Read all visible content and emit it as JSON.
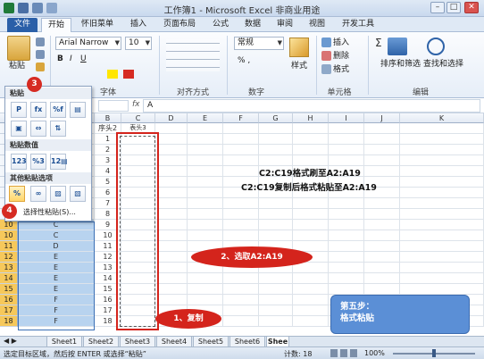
{
  "title_bar": {
    "title": "工作簿1 - Microsoft Excel 非商业用途"
  },
  "tabs": {
    "file": "文件",
    "items": [
      "开始",
      "怀旧菜单",
      "插入",
      "页面布局",
      "公式",
      "数据",
      "审阅",
      "视图",
      "开发工具"
    ]
  },
  "ribbon": {
    "paste_label": "粘贴",
    "font_name": "Arial Narrow",
    "font_size": "10",
    "group_font": "字体",
    "group_align": "对齐方式",
    "group_number": "数字",
    "group_cells": "单元格",
    "group_edit": "编辑",
    "number_format": "常规",
    "number_symbols": "% ,",
    "style_label": "样式",
    "insert_label": "插入",
    "delete_label": "删除",
    "format_label": "格式",
    "sort_filter_label": "排序和筛选",
    "find_select_label": "查找和选择"
  },
  "formula_bar": {
    "fx": "fx",
    "content": "A"
  },
  "columns": [
    "B",
    "C",
    "D",
    "E",
    "F",
    "G",
    "H",
    "I",
    "J",
    "K"
  ],
  "rows": [
    {
      "n": "1",
      "c": "",
      "b": "序头2"
    },
    {
      "n": "2",
      "c": "",
      "b": "1"
    },
    {
      "n": "3",
      "c": "",
      "b": "2"
    },
    {
      "n": "4",
      "c": "",
      "b": "3"
    },
    {
      "n": "5",
      "c": "",
      "b": "4"
    },
    {
      "n": "6",
      "c": "",
      "b": "5"
    },
    {
      "n": "7",
      "c": "",
      "b": "6"
    },
    {
      "n": "8",
      "c": "",
      "b": "7"
    },
    {
      "n": "9",
      "c": "",
      "b": "8"
    },
    {
      "n": "10",
      "c": "C",
      "b": "9"
    },
    {
      "n": "10",
      "c": "C",
      "b": "10"
    },
    {
      "n": "11",
      "c": "D",
      "b": "11"
    },
    {
      "n": "12",
      "c": "E",
      "b": "12"
    },
    {
      "n": "13",
      "c": "E",
      "b": "13"
    },
    {
      "n": "14",
      "c": "E",
      "b": "14"
    },
    {
      "n": "15",
      "c": "E",
      "b": "15"
    },
    {
      "n": "16",
      "c": "F",
      "b": "16"
    },
    {
      "n": "17",
      "c": "F",
      "b": "17"
    },
    {
      "n": "18",
      "c": "F",
      "b": "18"
    }
  ],
  "c1_header": "表头3",
  "paste_menu": {
    "section1": "粘贴",
    "section2": "粘贴数值",
    "section3": "其他粘贴选项",
    "special": "选择性粘贴(S)...",
    "badge3": "3",
    "badge4": "4"
  },
  "annotations": {
    "note1": "C2:C19格式刷至A2:A19",
    "note2": "C2:C19复制后格式粘贴至A2:A19",
    "select_oval": "2、选取A2:A19",
    "copy_oval": "1、复制",
    "step_box_line1": "第五步：",
    "step_box_line2": "格式粘贴"
  },
  "sheets": [
    "Sheet1",
    "Sheet2",
    "Sheet3",
    "Sheet4",
    "Sheet5",
    "Sheet6",
    "Shee"
  ],
  "status": {
    "message": "选定目标区域，然后按 ENTER 或选择“粘贴”",
    "count": "计数: 18",
    "zoom": "100%"
  }
}
